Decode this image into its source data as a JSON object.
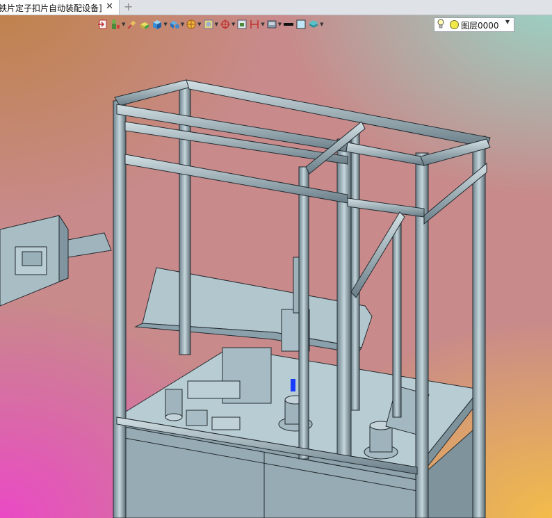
{
  "tab": {
    "title": "铁片定子扣片自动装配设备]",
    "close_label": "✕",
    "add_label": "+"
  },
  "toolbar": {
    "items": [
      {
        "name": "exit-sketch-icon",
        "has_dropdown": false
      },
      {
        "name": "person-constraint-icon",
        "has_dropdown": true
      },
      {
        "name": "paint-brush-icon",
        "has_dropdown": false
      },
      {
        "name": "material-icon",
        "has_dropdown": false
      },
      {
        "name": "view-cube-icon",
        "has_dropdown": true
      },
      {
        "name": "render-style-icon",
        "has_dropdown": true
      },
      {
        "name": "section-view-icon",
        "has_dropdown": true
      },
      {
        "name": "frame-icon",
        "has_dropdown": true
      },
      {
        "name": "pick-point-icon",
        "has_dropdown": true
      },
      {
        "name": "fit-view-icon",
        "has_dropdown": false
      },
      {
        "name": "dimension-icon",
        "has_dropdown": true
      },
      {
        "name": "display-mode-icon",
        "has_dropdown": true
      },
      {
        "name": "line-color-icon",
        "has_dropdown": false
      },
      {
        "name": "fill-color-icon",
        "has_dropdown": false
      },
      {
        "name": "layers-icon",
        "has_dropdown": true
      }
    ]
  },
  "layer_selector": {
    "value": "图层0000",
    "bulb_icon": "lightbulb-icon",
    "dropdown_icon": "chevron-down-icon"
  },
  "colors": {
    "frame": "#8fa4b0",
    "frame_dark": "#2a3338",
    "part": "#b9cdd4",
    "panel": "#a8c0c8",
    "accent_blue": "#1a3cff"
  },
  "viewport": {
    "content": "3D assembly model of stator clip automatic assembly equipment"
  }
}
